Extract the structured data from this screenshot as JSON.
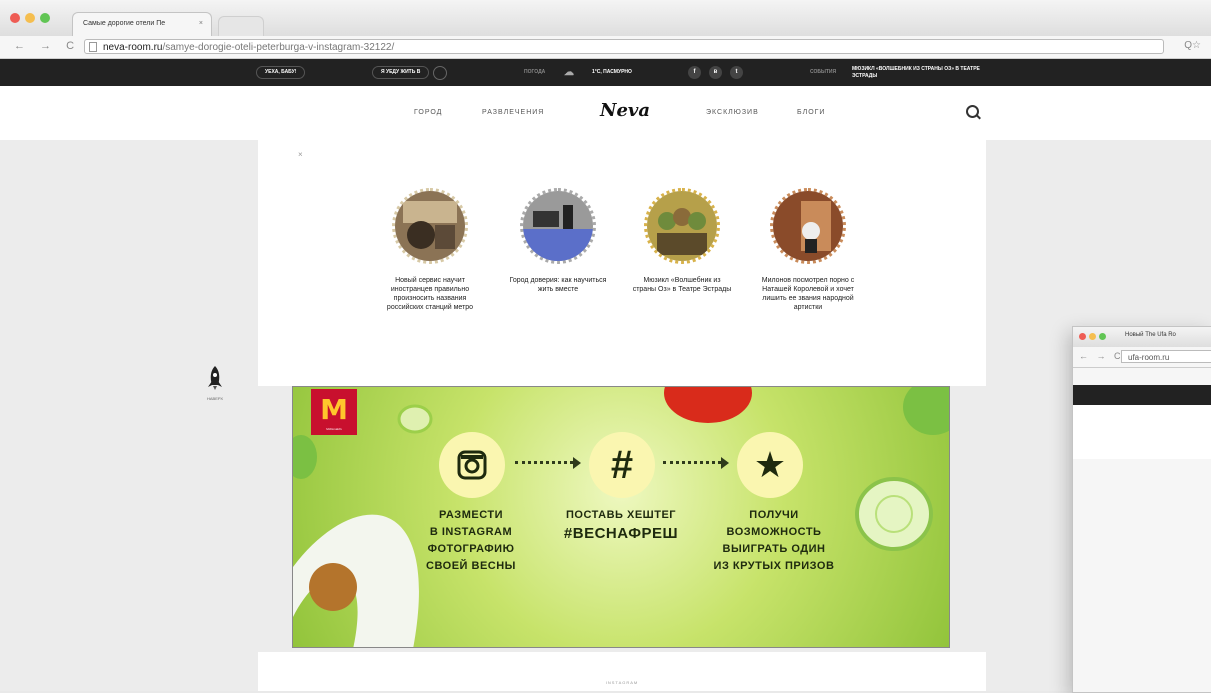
{
  "browser": {
    "tab_title": "Самые дорогие отели Пе",
    "tab_close": "×",
    "url_domain": "neva-room.ru",
    "url_path": "/samye-dorogie-oteli-peterburga-v-instagram-32122/",
    "nav_icons": "← → C",
    "right_icons": "Q☆"
  },
  "topbar": {
    "greeting": "УЕХА, БАБУ!",
    "relocate": "Я УЕДУ ЖИТЬ В",
    "weather_label": "ПОГОДА",
    "weather_value": "1°С, ПАСМУРНО",
    "social": [
      "f",
      "в",
      "t"
    ],
    "events_label": "СОБЫТИЯ",
    "event_text": "МЮЗИКЛ «ВОЛШЕБНИК ИЗ СТРАНЫ ОЗ» В ТЕАТРЕ ЭСТРАДЫ"
  },
  "site": {
    "menu": [
      "ГОРОД",
      "РАЗВЛЕЧЕНИЯ",
      "ЭКСКЛЮЗИВ",
      "БЛОГИ"
    ],
    "logo": "Neva"
  },
  "content": {
    "close": "×",
    "cards": [
      {
        "caption": "Новый сервис научит иностранцев правильно произносить названия российских станций метро"
      },
      {
        "caption": "Город доверия: как научиться жить вместе"
      },
      {
        "caption": "Мюзикл «Волшебник из страны Оз» в Театре Эстрады"
      },
      {
        "caption": "Милонов посмотрел порно с Наташей Королевой и хочет лишить ее звания народной артистки"
      }
    ]
  },
  "rocket": {
    "label": "НАВЕРХ"
  },
  "ad": {
    "brand": "M",
    "brand_sub": "McDonald's",
    "steps": [
      {
        "lines": [
          "РАЗМЕСТИ",
          "В INSTAGRAM",
          "ФОТОГРАФИЮ",
          "СВОЕЙ ВЕСНЫ"
        ]
      },
      {
        "lines": [
          "ПОСТАВЬ ХЕШТЕГ"
        ],
        "hashtag": "#ВЕСНАФРЕШ"
      },
      {
        "lines": [
          "ПОЛУЧИ",
          "ВОЗМОЖНОСТЬ",
          "ВЫИГРАТЬ ОДИН",
          "ИЗ КРУТЫХ ПРИЗОВ"
        ]
      }
    ],
    "hash_symbol": "#",
    "star_symbol": "★"
  },
  "bottom": {
    "label": "INSTAGRAM"
  },
  "second_browser": {
    "tab_title": "Новый The Ufa Ro",
    "url": "ufa-room.ru",
    "nav_icons": "← → C"
  },
  "colors": {
    "accent": "#c8102e",
    "ad_dark": "#1e2a0e",
    "topbar": "#222222"
  }
}
